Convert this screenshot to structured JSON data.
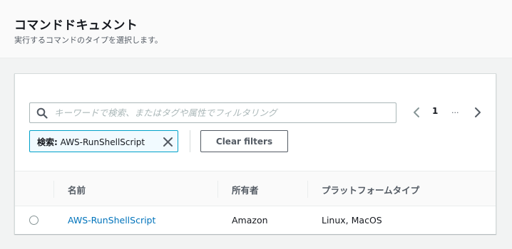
{
  "header": {
    "title": "コマンドドキュメント",
    "subtitle": "実行するコマンドのタイプを選択します。"
  },
  "search": {
    "placeholder": "キーワードで検索、またはタグや属性でフィルタリング",
    "value": ""
  },
  "pagination": {
    "current_page": "1",
    "ellipsis": "..."
  },
  "filter_token": {
    "prefix": "検索:",
    "value": "AWS-RunShellScript"
  },
  "clear_filters_label": "Clear filters",
  "table": {
    "columns": [
      "名前",
      "所有者",
      "プラットフォームタイプ"
    ],
    "rows": [
      {
        "name": "AWS-RunShellScript",
        "owner": "Amazon",
        "platform": "Linux, MacOS",
        "selected": false
      }
    ]
  },
  "colors": {
    "link": "#0073bb",
    "token_border": "#00a1c9",
    "token_bg": "#f1faff",
    "page_bg": "#f2f3f3"
  },
  "icons": [
    "search-icon",
    "chevron-left-icon",
    "chevron-right-icon",
    "close-icon"
  ]
}
